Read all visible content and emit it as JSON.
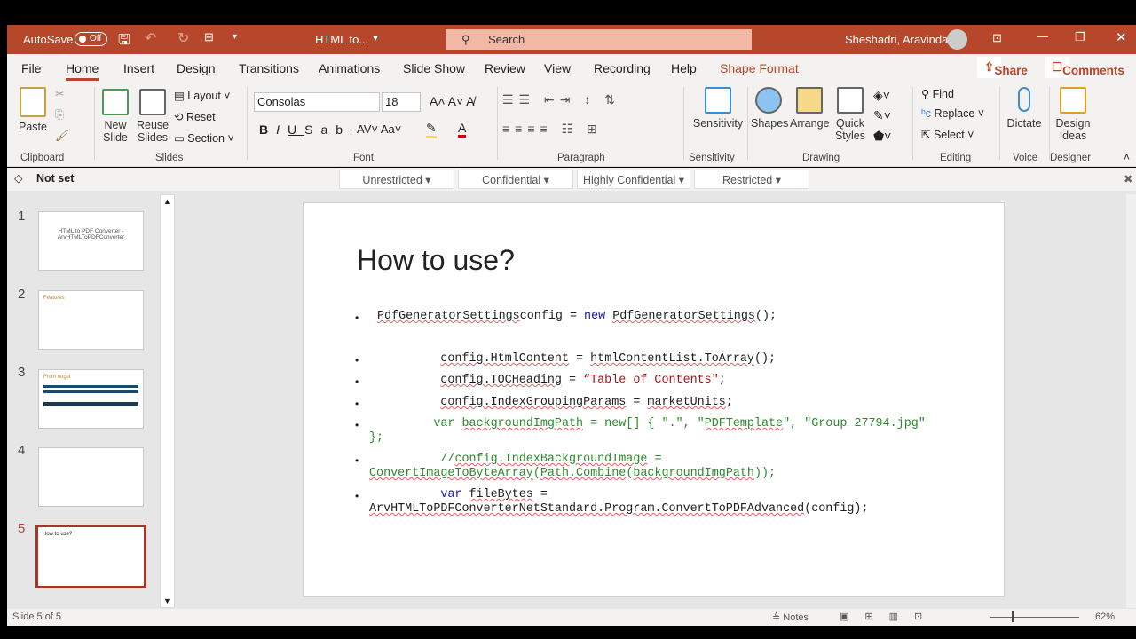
{
  "titlebar": {
    "autosave": "AutoSave",
    "autosave_state": "Off",
    "doc_title": "HTML to...",
    "search": "Search",
    "user": "Sheshadri, Aravinda"
  },
  "tabs": [
    "File",
    "Home",
    "Insert",
    "Design",
    "Transitions",
    "Animations",
    "Slide Show",
    "Review",
    "View",
    "Recording",
    "Help",
    "Shape Format"
  ],
  "share": "Share",
  "comments": "Comments",
  "ribbon": {
    "paste": "Paste",
    "new_slide": "New Slide",
    "reuse": "Reuse Slides",
    "layout": "Layout",
    "reset": "Reset",
    "section": "Section",
    "font": "Consolas",
    "size": "18",
    "sensitivity": "Sensitivity",
    "shapes": "Shapes",
    "arrange": "Arrange",
    "quick_styles": "Quick Styles",
    "find": "Find",
    "replace": "Replace",
    "select": "Select",
    "dictate": "Dictate",
    "design_ideas": "Design Ideas",
    "groups": {
      "clipboard": "Clipboard",
      "slides": "Slides",
      "font": "Font",
      "paragraph": "Paragraph",
      "sensitivity": "Sensitivity",
      "drawing": "Drawing",
      "editing": "Editing",
      "voice": "Voice",
      "designer": "Designer"
    }
  },
  "sensbar": {
    "label": "Not set",
    "options": [
      "Unrestricted",
      "Confidential",
      "Highly Confidential",
      "Restricted"
    ]
  },
  "thumbnails": [
    {
      "num": "1",
      "title": "HTML to PDF Converter -ArvHTMLToPDFConverter"
    },
    {
      "num": "2",
      "title": "Features"
    },
    {
      "num": "3",
      "title": "From nuget"
    },
    {
      "num": "4",
      "title": ""
    },
    {
      "num": "5",
      "title": "How to use?"
    }
  ],
  "slide": {
    "title": "How to use?",
    "lines": [
      [
        [
          "sq",
          "PdfGeneratorSettings"
        ],
        [
          "",
          "config = "
        ],
        [
          "kw",
          "new "
        ],
        [
          "sq",
          "PdfGeneratorSettings"
        ],
        [
          "",
          "();"
        ]
      ],
      [
        [
          "",
          "          "
        ],
        [
          "sq",
          "config.HtmlContent"
        ],
        [
          "",
          " = "
        ],
        [
          "sq",
          "htmlContentList.ToArray"
        ],
        [
          "",
          "();"
        ]
      ],
      [
        [
          "",
          "          "
        ],
        [
          "sq",
          "config.TOCHeading"
        ],
        [
          "",
          " = "
        ],
        [
          "str",
          "“Table of Contents\""
        ],
        [
          "",
          ";"
        ]
      ],
      [
        [
          "",
          "          "
        ],
        [
          "sq",
          "config.IndexGroupingParams"
        ],
        [
          "",
          " = "
        ],
        [
          "sq",
          "marketUnits"
        ],
        [
          "",
          ";"
        ]
      ],
      [
        [
          "cm",
          "         var "
        ],
        [
          "cm sq",
          "backgroundImgPath"
        ],
        [
          "cm",
          " = new[] { \".\", \""
        ],
        [
          "cm sq",
          "PDFTemplate"
        ],
        [
          "cm",
          "\", \"Group 27794.jpg\"\n};"
        ]
      ],
      [
        [
          "cm",
          "          //"
        ],
        [
          "cm sq",
          "config.IndexBackgroundImage"
        ],
        [
          "cm",
          " =\n"
        ],
        [
          "cm sq",
          "ConvertImageToByteArray"
        ],
        [
          "cm",
          "("
        ],
        [
          "cm sq",
          "Path.Combine"
        ],
        [
          "cm",
          "("
        ],
        [
          "cm sq",
          "backgroundImgPath"
        ],
        [
          "cm",
          "));"
        ]
      ],
      [
        [
          "",
          "          "
        ],
        [
          "kw",
          "var "
        ],
        [
          "sq",
          "fileBytes"
        ],
        [
          "",
          " =\n"
        ],
        [
          "sq",
          "ArvHTMLToPDFConverterNetStandard.Program.ConvertToPDFAdvanced"
        ],
        [
          "",
          "(config);"
        ]
      ]
    ]
  },
  "status": {
    "slide": "Slide 5 of 5",
    "notes": "Notes",
    "zoom": "62%"
  }
}
